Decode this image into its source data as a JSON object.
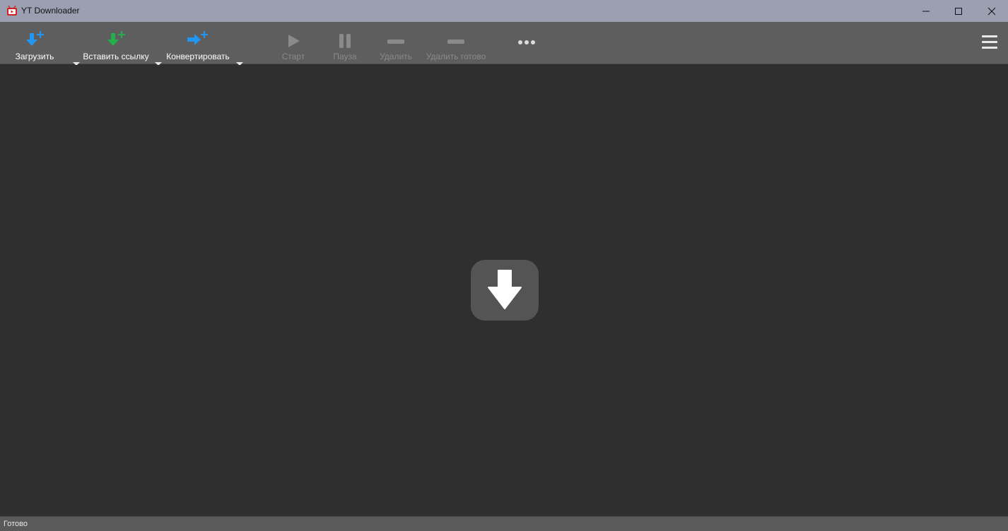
{
  "window": {
    "title": "YT Downloader"
  },
  "toolbar": {
    "buttons": [
      {
        "id": "download",
        "label": "Загрузить",
        "icon": "download-plus-icon",
        "color": "#2196f3",
        "enabled": true,
        "has_dropdown": true
      },
      {
        "id": "paste-link",
        "label": "Вставить ссылку",
        "icon": "paste-link-plus-icon",
        "color": "#22b04a",
        "enabled": true,
        "has_dropdown": true
      },
      {
        "id": "convert",
        "label": "Конвертировать",
        "icon": "convert-plus-icon",
        "color": "#2196f3",
        "enabled": true,
        "has_dropdown": true
      },
      {
        "id": "start",
        "label": "Старт",
        "icon": "play-icon",
        "enabled": false
      },
      {
        "id": "pause",
        "label": "Пауза",
        "icon": "pause-icon",
        "enabled": false
      },
      {
        "id": "delete",
        "label": "Удалить",
        "icon": "minus-icon",
        "enabled": false
      },
      {
        "id": "delete-done",
        "label": "Удалить готово",
        "icon": "minus-icon",
        "enabled": false
      }
    ],
    "more_icon": "more-dots-icon",
    "menu_icon": "hamburger-menu-icon"
  },
  "main": {
    "empty_state_icon": "download-arrow-icon"
  },
  "status": {
    "text": "Готово"
  },
  "colors": {
    "titlebar": "#9aa0b1",
    "toolbar": "#5e5e5e",
    "background": "#2f2f2f",
    "accent_blue": "#2196f3",
    "accent_green": "#22b04a"
  }
}
